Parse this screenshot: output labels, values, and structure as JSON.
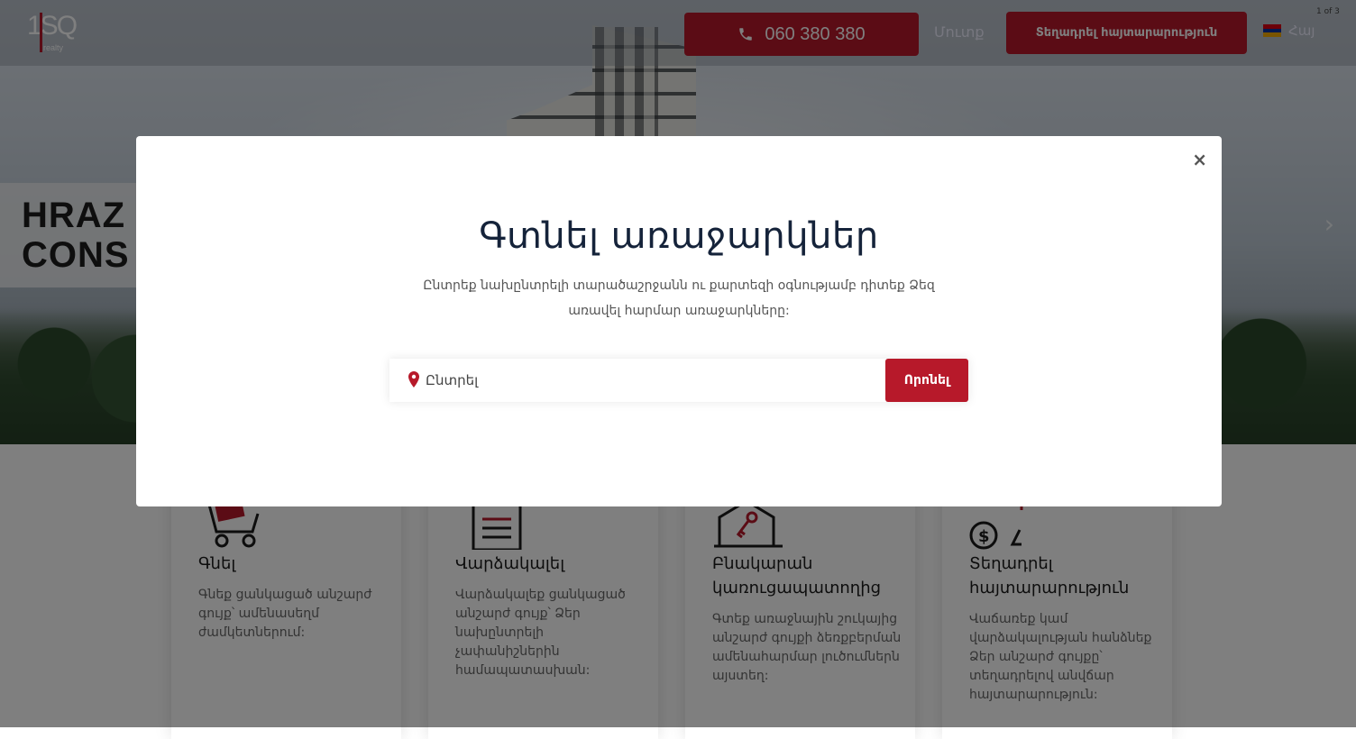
{
  "header": {
    "logo_number": "1SQ",
    "logo_sub": "realty",
    "phone": "060 380 380",
    "login": "Մուտք",
    "post_button": "Տեղադրել հայտարարություն",
    "language": "Հայ",
    "slider_counter": "1 of 3",
    "flag_colors": [
      "#d90012",
      "#0033a0",
      "#f2a800"
    ]
  },
  "hero": {
    "sign_line1": "HRAZ",
    "sign_line2": "CONS"
  },
  "cards": [
    {
      "title": "Գնել",
      "text": "Գնեք ցանկացած անշարժ գույք՝ ամենասեղմ ժամկետներում:",
      "icon": "shopping-cart-icon"
    },
    {
      "title": "Վարձակալել",
      "text": "Վարձակալեք ցանկացած անշարժ գույք՝ Ձեր նախընտրելի չափանիշներին համապատասխան:",
      "icon": "document-icon"
    },
    {
      "title": "Բնակարան կառուցապատողից",
      "text": "Գտեք առաջնային շուկայից անշարժ գույքի ձեռքբերման ամենահարմար լուծումներն այստեղ:",
      "icon": "house-key-icon"
    },
    {
      "title": "Տեղադրել հայտարարություն",
      "text": "Վաճառեք կամ վարձակալության հանձնեք Ձեր անշարժ գույքը՝ տեղադրելով անվճար հայտարարություն:",
      "icon": "money-exchange-icon"
    }
  ],
  "modal": {
    "title": "Գտնել առաջարկներ",
    "description": "Ընտրեք նախընտրելի տարածաշրջանն ու քարտեզի օգնությամբ դիտեք Ձեզ առավել հարմար առաջարկները:",
    "search_placeholder": "Ընտրել",
    "search_button": "Որոնել",
    "close_glyph": "×"
  },
  "colors": {
    "accent": "#b7192a",
    "title": "#15233a"
  }
}
